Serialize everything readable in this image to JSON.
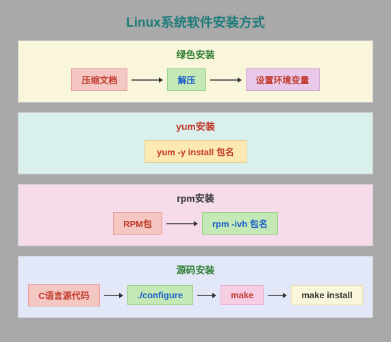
{
  "title": "Linux系统软件安装方式",
  "sections": {
    "green": {
      "title": "绿色安装",
      "steps": [
        "压缩文档",
        "解压",
        "设置环境变量"
      ]
    },
    "yum": {
      "title": "yum安装",
      "command": "yum -y install 包名"
    },
    "rpm": {
      "title": "rpm安装",
      "steps": [
        "RPM包",
        "rpm -ivh 包名"
      ]
    },
    "src": {
      "title": "源码安装",
      "steps": [
        "C语言源代码",
        "./configure",
        "make",
        "make install"
      ]
    }
  }
}
